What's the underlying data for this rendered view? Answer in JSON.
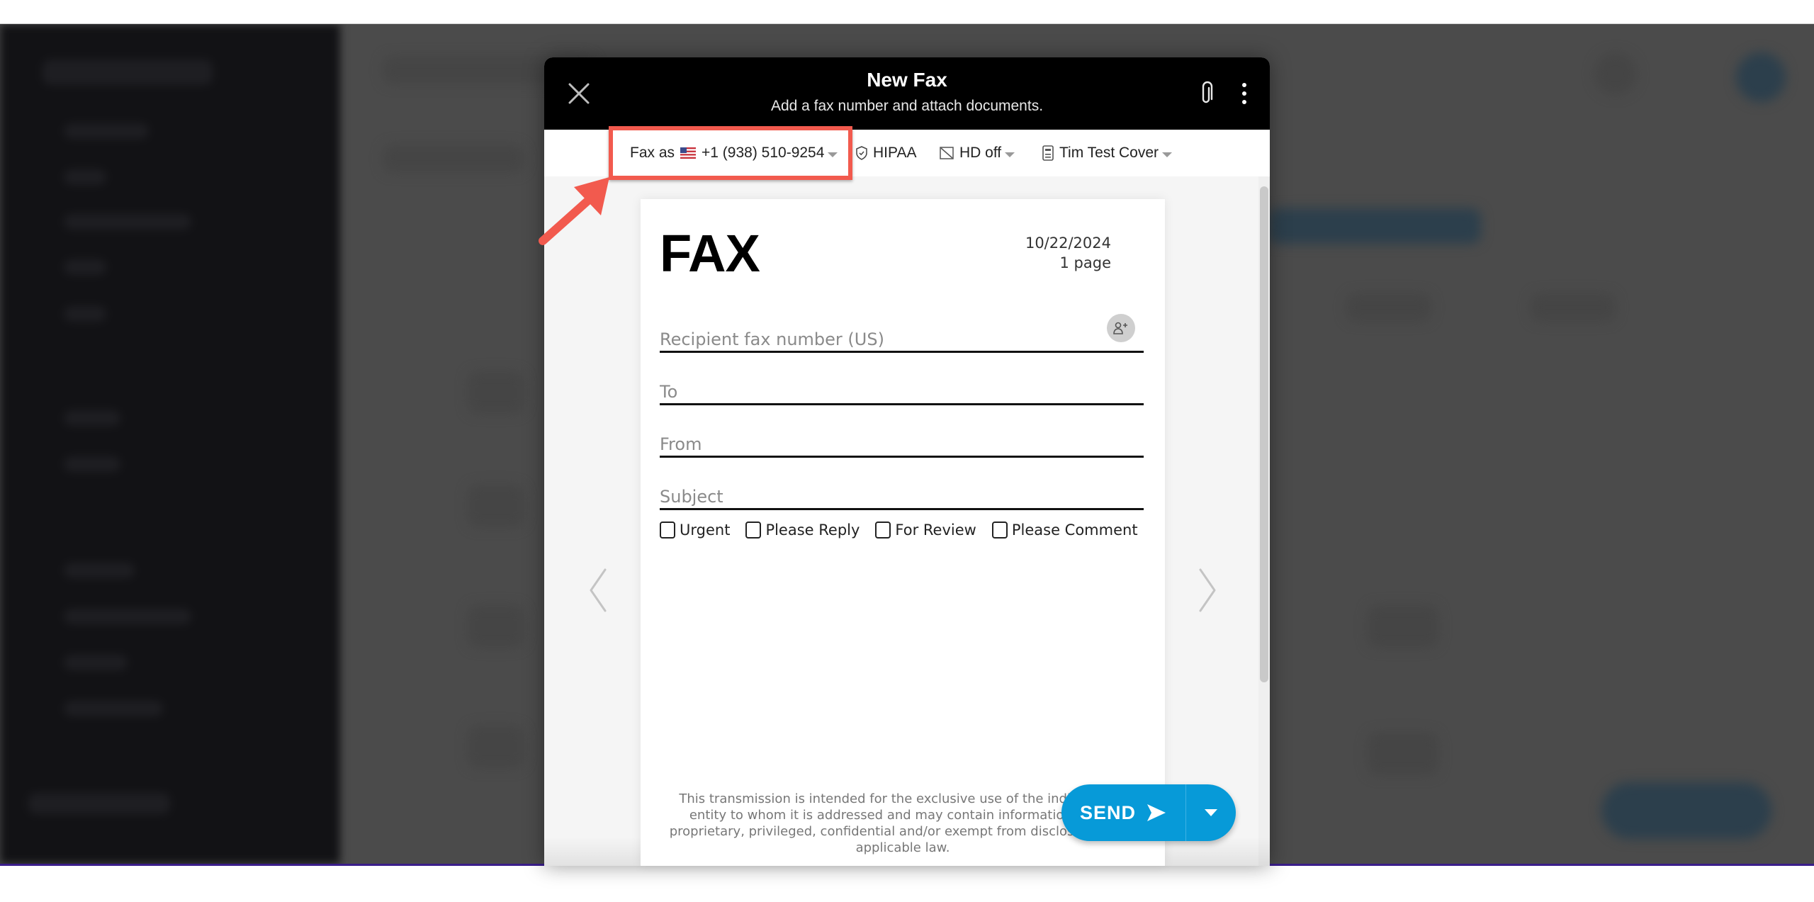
{
  "modal": {
    "title": "New Fax",
    "subtitle": "Add a fax number and attach documents.",
    "close_icon": "close-icon",
    "attach_icon": "paperclip-icon",
    "more_icon": "more-vertical-icon"
  },
  "toolbar": {
    "fax_as_label": "Fax as",
    "fax_as_flag": "us-flag-icon",
    "fax_as_number": "+1 (938) 510-9254",
    "hipaa_label": "HIPAA",
    "hd_label": "HD off",
    "cover_label": "Tim Test Cover"
  },
  "cover_page": {
    "title": "FAX",
    "date": "10/22/2024",
    "pages": "1 page",
    "fields": {
      "recipient_placeholder": "Recipient fax number (US)",
      "to_placeholder": "To",
      "from_placeholder": "From",
      "subject_placeholder": "Subject"
    },
    "checkboxes": [
      {
        "label": "Urgent",
        "checked": false
      },
      {
        "label": "Please Reply",
        "checked": false
      },
      {
        "label": "For Review",
        "checked": false
      },
      {
        "label": "Please Comment",
        "checked": false
      }
    ],
    "disclaimer": "This transmission is intended for the exclusive use of the individual or entity to whom it is addressed and may contain information that is proprietary, privileged, confidential and/or exempt from disclosure under applicable law."
  },
  "actions": {
    "send_label": "SEND"
  },
  "colors": {
    "accent": "#079ad8",
    "annotation": "#f25a4e",
    "header_bg": "#000000"
  }
}
